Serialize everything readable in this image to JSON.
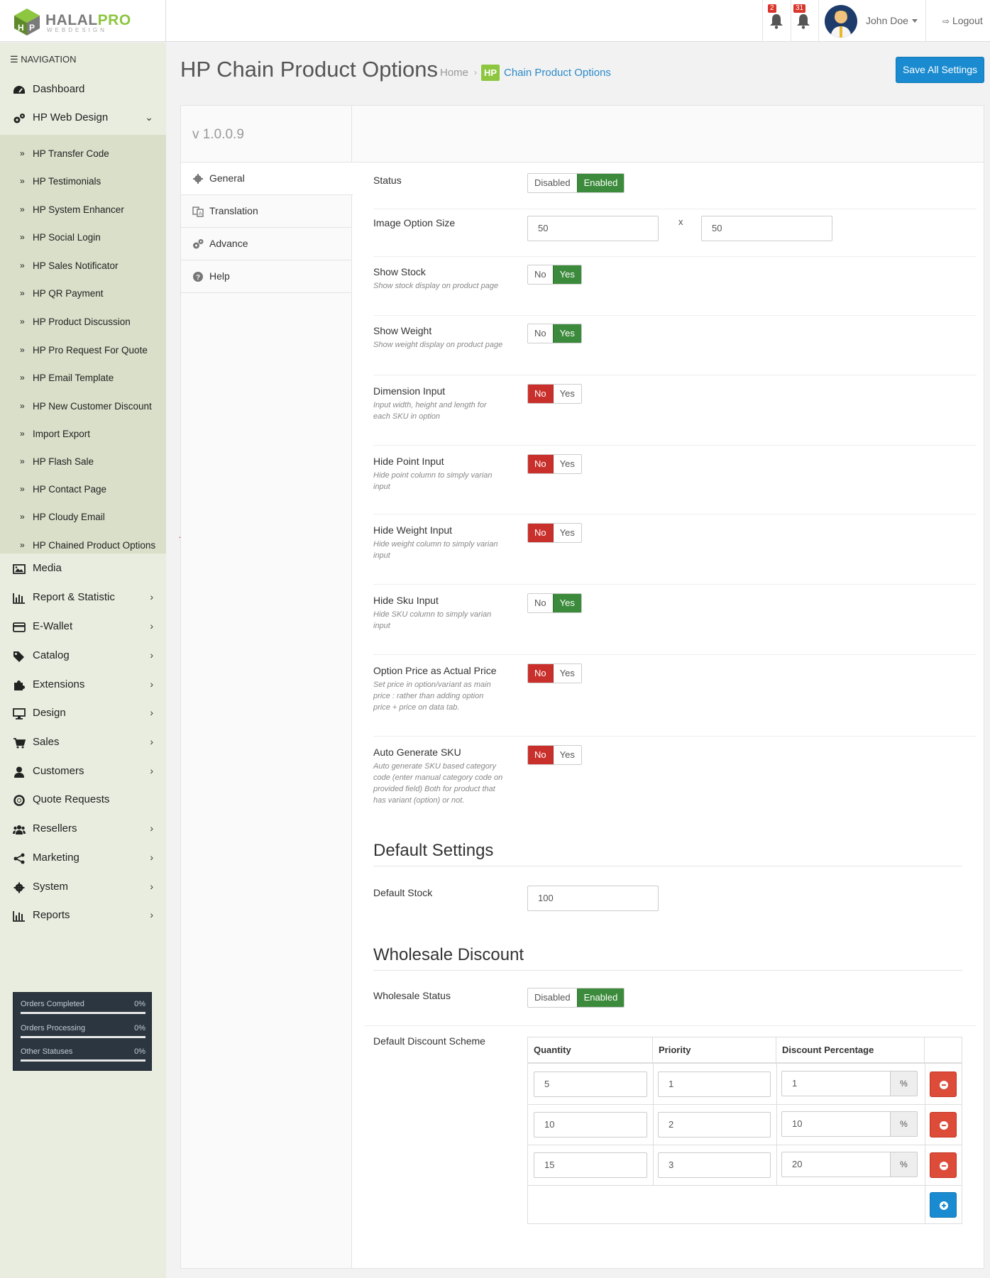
{
  "header": {
    "logo_main": "HALAL",
    "logo_pro": "PRO",
    "logo_sub": "WEBDESIGN",
    "notif1_count": "2",
    "notif2_count": "31",
    "user_name": "John Doe",
    "logout_label": "Logout"
  },
  "sidebar": {
    "nav_heading": "NAVIGATION",
    "items_top": [
      {
        "label": "Dashboard",
        "icon": "dashboard-icon"
      },
      {
        "label": "HP Web Design",
        "icon": "cogs-icon"
      }
    ],
    "submenu": [
      "HP Transfer Code",
      "HP Testimonials",
      "HP System Enhancer",
      "HP Social Login",
      "HP Sales Notificator",
      "HP QR Payment",
      "HP Product Discussion",
      "HP Pro Request For Quote",
      "HP Email Template",
      "HP New Customer Discount",
      "Import Export",
      "HP Flash Sale",
      "HP Contact Page",
      "HP Cloudy Email",
      "HP Chained Product Options"
    ],
    "items_bottom": [
      {
        "label": "Media",
        "icon": "image-icon"
      },
      {
        "label": "Report & Statistic",
        "icon": "bar-chart-icon"
      },
      {
        "label": "E-Wallet",
        "icon": "credit-card-icon"
      },
      {
        "label": "Catalog",
        "icon": "tags-icon"
      },
      {
        "label": "Extensions",
        "icon": "puzzle-icon"
      },
      {
        "label": "Design",
        "icon": "desktop-icon"
      },
      {
        "label": "Sales",
        "icon": "cart-icon"
      },
      {
        "label": "Customers",
        "icon": "user-icon"
      },
      {
        "label": "Quote Requests",
        "icon": "lifebuoy-icon"
      },
      {
        "label": "Resellers",
        "icon": "users-icon"
      },
      {
        "label": "Marketing",
        "icon": "share-icon"
      },
      {
        "label": "System",
        "icon": "cog-icon"
      },
      {
        "label": "Reports",
        "icon": "bar-chart-icon"
      }
    ],
    "stats": [
      {
        "label": "Orders Completed",
        "pct": "0%"
      },
      {
        "label": "Orders Processing",
        "pct": "0%"
      },
      {
        "label": "Other Statuses",
        "pct": "0%"
      }
    ]
  },
  "page": {
    "title": "HP Chain Product Options",
    "breadcrumb_home": "Home",
    "breadcrumb_sep": "›",
    "breadcrumb_badge": "HP",
    "breadcrumb_current": "Chain Product Options",
    "save_label": "Save All Settings",
    "version": "v 1.0.0.9"
  },
  "tabs": [
    {
      "label": "General",
      "icon": "cog-icon"
    },
    {
      "label": "Translation",
      "icon": "language-icon"
    },
    {
      "label": "Advance",
      "icon": "cogs-icon"
    },
    {
      "label": "Help",
      "icon": "question-circle-icon"
    }
  ],
  "general": {
    "status": {
      "label": "Status",
      "off": "Disabled",
      "on": "Enabled",
      "value": "Enabled"
    },
    "image_size": {
      "label": "Image Option Size",
      "width": "50",
      "x": "x",
      "height": "50"
    },
    "show_stock": {
      "label": "Show Stock",
      "help": "Show stock display on product page",
      "no": "No",
      "yes": "Yes",
      "value": "Yes"
    },
    "show_weight": {
      "label": "Show Weight",
      "help": "Show weight display on product page",
      "no": "No",
      "yes": "Yes",
      "value": "Yes"
    },
    "dimension_input": {
      "label": "Dimension Input",
      "help": "Input width, height and length for each SKU in option",
      "no": "No",
      "yes": "Yes",
      "value": "No"
    },
    "hide_point": {
      "label": "Hide Point Input",
      "help": "Hide point column to simply varian input",
      "no": "No",
      "yes": "Yes",
      "value": "No"
    },
    "hide_weight": {
      "label": "Hide Weight Input",
      "help": "Hide weight column to simply varian input",
      "no": "No",
      "yes": "Yes",
      "value": "No"
    },
    "hide_sku": {
      "label": "Hide Sku Input",
      "help": "Hide SKU column to simply varian input",
      "no": "No",
      "yes": "Yes",
      "value": "Yes"
    },
    "option_price": {
      "label": "Option Price as Actual Price",
      "help": "Set price in option/variant as main price : rather than adding option price + price on data tab.",
      "no": "No",
      "yes": "Yes",
      "value": "No"
    },
    "auto_sku": {
      "label": "Auto Generate SKU",
      "help": "Auto generate SKU based category code (enter manual category code on provided field) Both for product that has variant (option) or not.",
      "no": "No",
      "yes": "Yes",
      "value": "No"
    }
  },
  "default_settings": {
    "heading": "Default Settings",
    "stock_label": "Default Stock",
    "stock_value": "100"
  },
  "wholesale": {
    "heading": "Wholesale Discount",
    "status_label": "Wholesale Status",
    "off": "Disabled",
    "on": "Enabled",
    "value": "Enabled",
    "scheme_label": "Default Discount Scheme",
    "columns": [
      "Quantity",
      "Priority",
      "Discount Percentage"
    ],
    "percent_sign": "%",
    "rows": [
      {
        "quantity": "5",
        "priority": "1",
        "discount": "1"
      },
      {
        "quantity": "10",
        "priority": "2",
        "discount": "10"
      },
      {
        "quantity": "15",
        "priority": "3",
        "discount": "20"
      }
    ]
  },
  "colors": {
    "accent_blue": "#1a8bd0",
    "toggle_green": "#3c8b3c",
    "toggle_red": "#c9302c",
    "sidebar_bg": "#e8eddf",
    "submenu_bg": "#d9dfc9",
    "arrow_red": "#e02020"
  }
}
